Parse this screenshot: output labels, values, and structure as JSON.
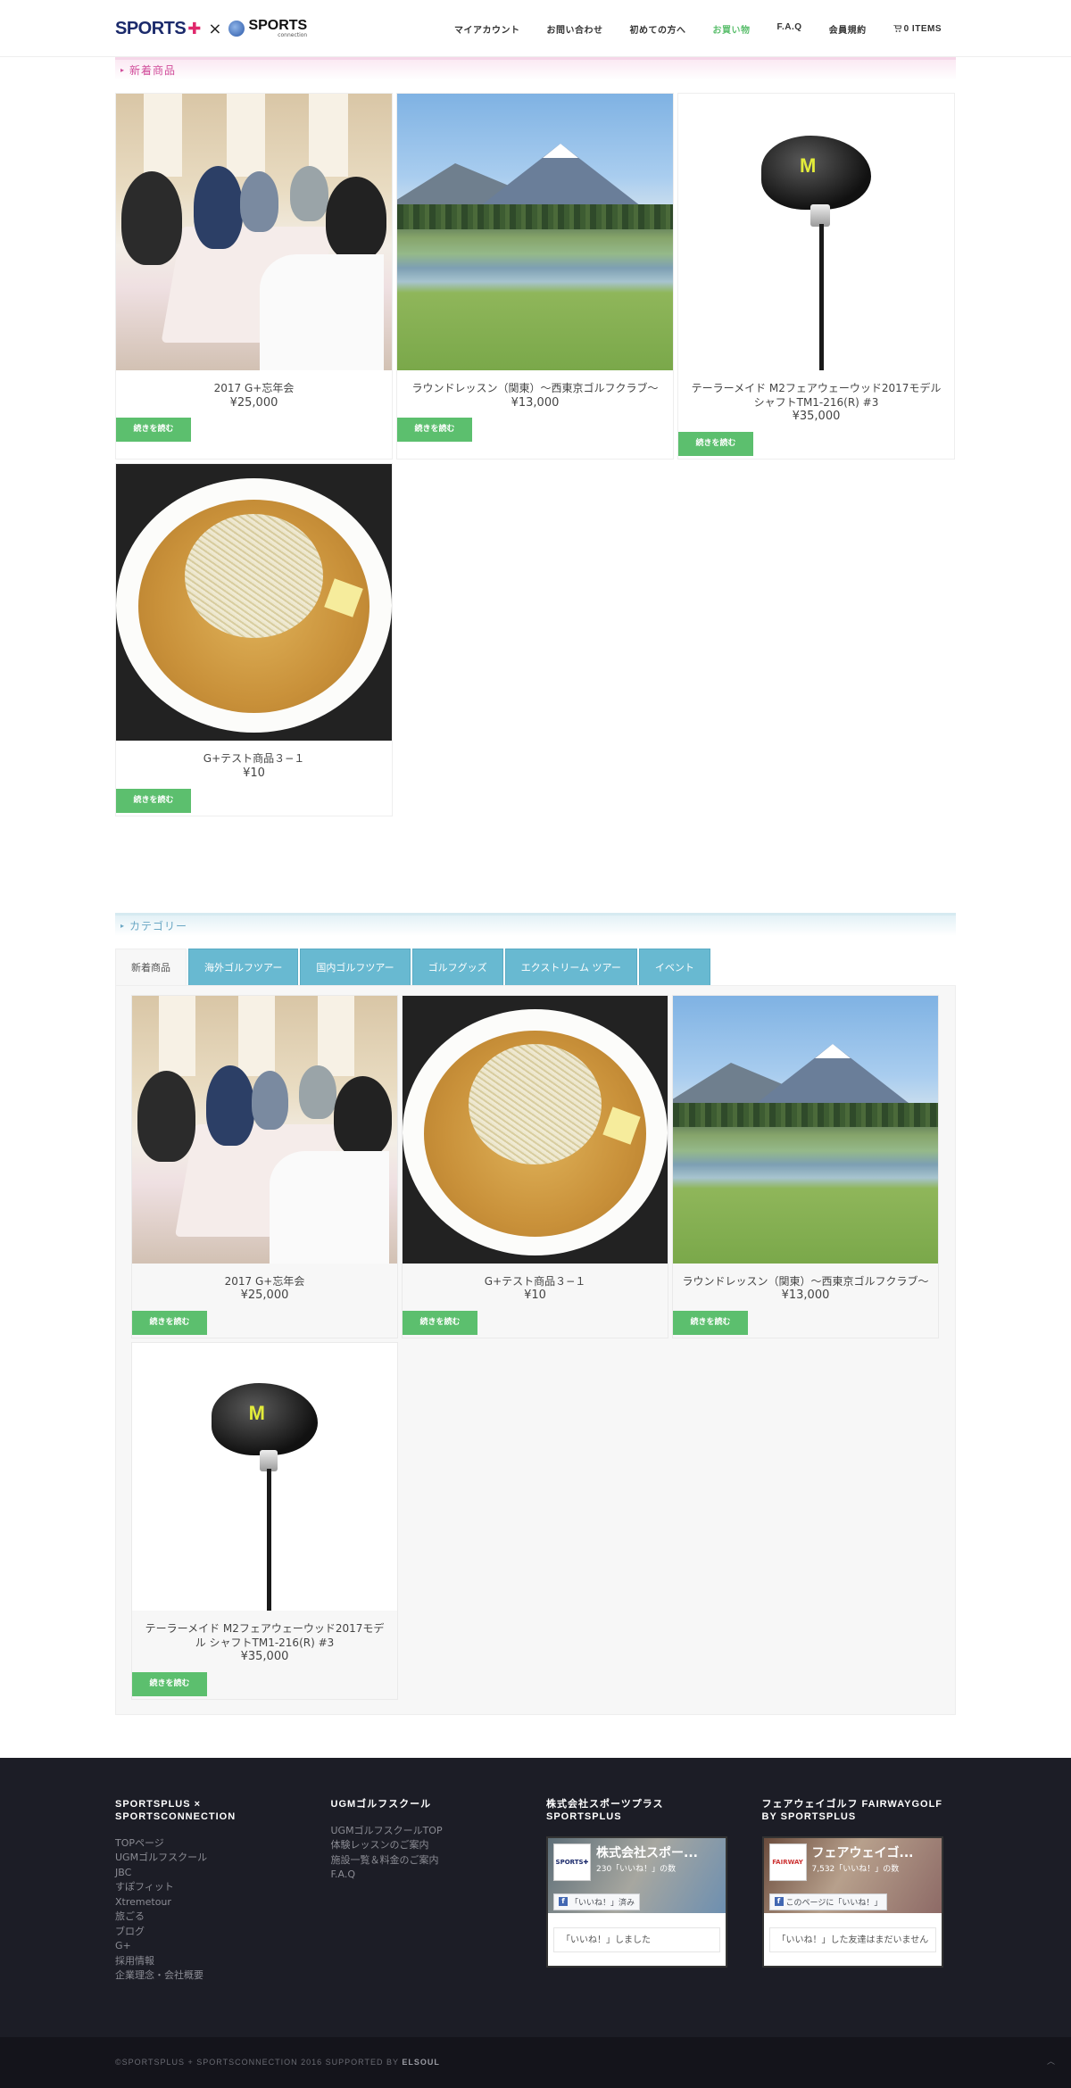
{
  "header": {
    "logo_sports": "SPORTS",
    "logo_plus": "✚",
    "logo_x": "×",
    "logo_sc": "SPORTS",
    "logo_sc_sub": "connection",
    "nav": [
      {
        "label": "マイアカウント"
      },
      {
        "label": "お問い合わせ"
      },
      {
        "label": "初めての方へ"
      },
      {
        "label": "お買い物",
        "active": true
      },
      {
        "label": "F.A.Q"
      },
      {
        "label": "会員規約"
      }
    ],
    "cart_label": "0 ITEMS"
  },
  "new_items": {
    "heading": "新着商品",
    "products": [
      {
        "name": "2017 G+忘年会",
        "price": "¥25,000",
        "button": "続きを読む"
      },
      {
        "name": "ラウンドレッスン（関東）〜西東京ゴルフクラブ〜",
        "price": "¥13,000",
        "button": "続きを読む"
      },
      {
        "name": "テーラーメイド M2フェアウェーウッド2017モデル シャフトTM1-216(R) #3",
        "price": "¥35,000",
        "button": "続きを読む"
      },
      {
        "name": "G+テスト商品３−１",
        "price": "¥10",
        "button": "続きを読む"
      }
    ]
  },
  "categories": {
    "heading": "カテゴリー",
    "tabs": [
      {
        "label": "新着商品",
        "active": true
      },
      {
        "label": "海外ゴルフツアー"
      },
      {
        "label": "国内ゴルフツアー"
      },
      {
        "label": "ゴルフグッズ"
      },
      {
        "label": "エクストリーム ツアー"
      },
      {
        "label": "イベント"
      }
    ],
    "products": [
      {
        "name": "2017 G+忘年会",
        "price": "¥25,000",
        "button": "続きを読む"
      },
      {
        "name": "G+テスト商品３−１",
        "price": "¥10",
        "button": "続きを読む"
      },
      {
        "name": "ラウンドレッスン（関東）〜西東京ゴルフクラブ〜",
        "price": "¥13,000",
        "button": "続きを読む"
      },
      {
        "name": "テーラーメイド M2フェアウェーウッド2017モデル シャフトTM1-216(R) #3",
        "price": "¥35,000",
        "button": "続きを読む"
      }
    ]
  },
  "footer": {
    "col1": {
      "title": "SPORTSPLUS × SPORTSCONNECTION",
      "links": [
        "TOPページ",
        "UGMゴルフスクール",
        "JBC",
        "すぽフィット",
        "Xtremetour",
        "旅ごる",
        "ブログ",
        "G+",
        "採用情報",
        "企業理念・会社概要"
      ]
    },
    "col2": {
      "title": "UGMゴルフスクール",
      "links": [
        "UGMゴルフスクールTOP",
        "体験レッスンのご案内",
        "施設一覧＆料金のご案内",
        "F.A.Q"
      ]
    },
    "col3": {
      "title": "株式会社スポーツプラス SPORTSPLUS",
      "fb_name": "株式会社スポー...",
      "fb_likes": "230「いいね！」の数",
      "fb_like_btn": "「いいね！」済み",
      "fb_status": "「いいね！」しました",
      "fb_avatar": "SPORTS✚"
    },
    "col4": {
      "title": "フェアウェイゴルフ FAIRWAYGOLF BY SPORTSPLUS",
      "fb_name": "フェアウェイゴ...",
      "fb_likes": "7,532「いいね！」の数",
      "fb_like_btn": "このページに「いいね！」",
      "fb_status": "「いいね！」した友達はまだいません",
      "fb_avatar": "FAIRWAY"
    },
    "copyright_prefix": "©SPORTSPLUS + SPORTSCONNECTION 2016 SUPPORTED BY",
    "copyright_brand": "ELSOUL"
  }
}
